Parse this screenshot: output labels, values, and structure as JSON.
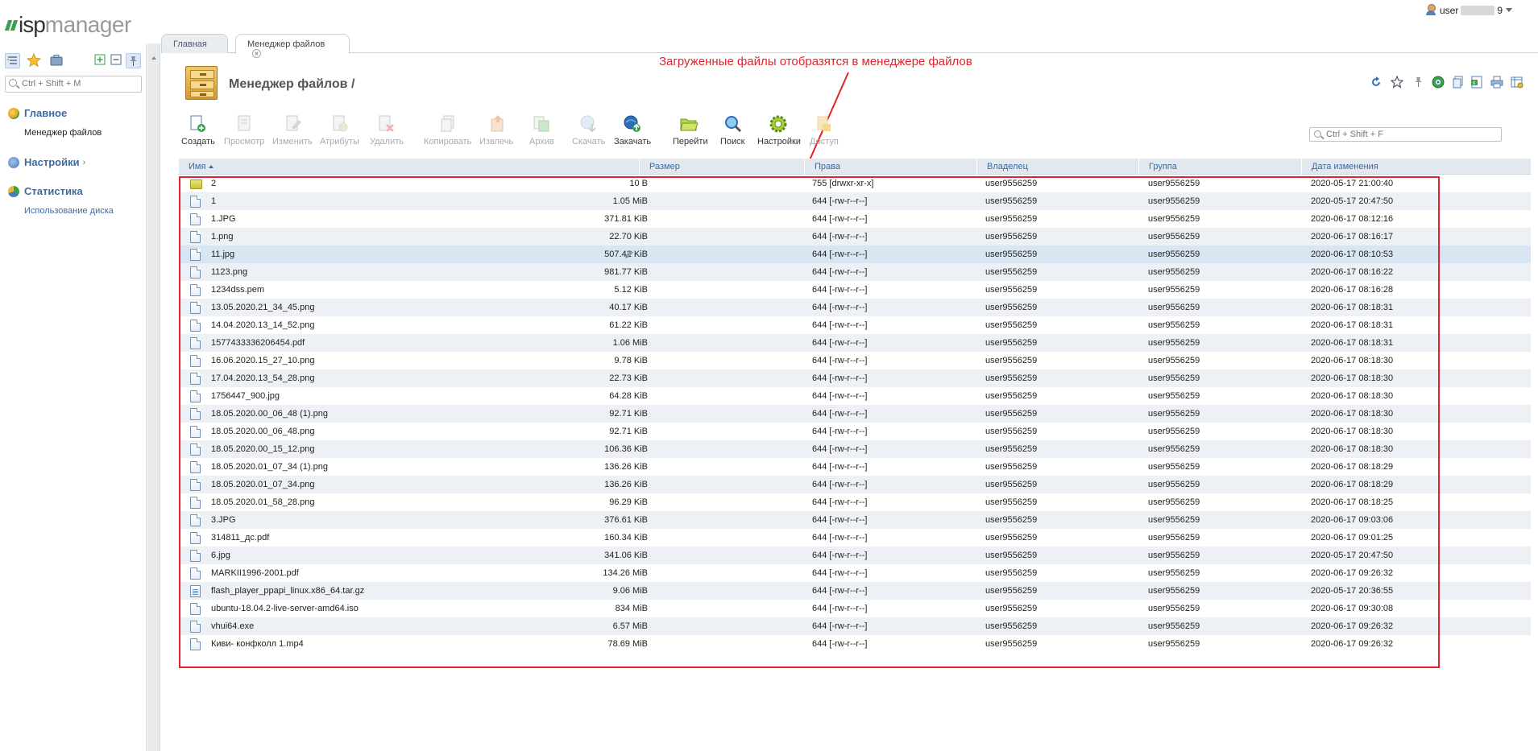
{
  "app": {
    "logo_isp": "isp",
    "logo_manager": "manager",
    "user_name": "user",
    "user_suffix": "9"
  },
  "sidebar": {
    "search_placeholder": "Ctrl + Shift + M",
    "sections": [
      {
        "label": "Главное",
        "items": [
          {
            "label": "Менеджер файлов"
          }
        ]
      },
      {
        "label": "Настройки",
        "chevron": "›"
      },
      {
        "label": "Статистика",
        "items": [
          {
            "label": "Использование диска"
          }
        ]
      }
    ]
  },
  "tabs": [
    {
      "label": "Главная",
      "active": false
    },
    {
      "label": "Менеджер файлов",
      "active": true
    }
  ],
  "page": {
    "title": "Менеджер файлов /"
  },
  "annotation": {
    "text": "Загруженные файлы отобразятся в менеджере файлов",
    "color": "#e3232b"
  },
  "toolbar": {
    "buttons": [
      {
        "label": "Создать",
        "icon": "file-plus-icon",
        "enabled": true
      },
      {
        "label": "Просмотр",
        "icon": "file-view-icon",
        "enabled": false
      },
      {
        "label": "Изменить",
        "icon": "file-edit-icon",
        "enabled": false
      },
      {
        "label": "Атрибуты",
        "icon": "attributes-gear-icon",
        "enabled": false
      },
      {
        "label": "Удалить",
        "icon": "delete-icon",
        "enabled": false
      },
      {
        "label": "Копировать",
        "icon": "copy-icon",
        "enabled": false
      },
      {
        "label": "Извлечь",
        "icon": "extract-icon",
        "enabled": false
      },
      {
        "label": "Архив",
        "icon": "archive-icon",
        "enabled": false
      },
      {
        "label": "Скачать",
        "icon": "download-icon",
        "enabled": false
      },
      {
        "label": "Закачать",
        "icon": "upload-icon",
        "enabled": true
      },
      {
        "label": "Перейти",
        "icon": "folder-open-icon",
        "enabled": true
      },
      {
        "label": "Поиск",
        "icon": "search-icon",
        "enabled": true
      },
      {
        "label": "Настройки",
        "icon": "settings-gear-icon",
        "enabled": true
      },
      {
        "label": "Доступ",
        "icon": "access-lock-icon",
        "enabled": false
      }
    ],
    "search_placeholder": "Ctrl + Shift + F"
  },
  "right_icons": [
    "refresh-icon",
    "favorite-star-icon",
    "pin-icon",
    "globe-icon",
    "copy-page-icon",
    "export-excel-icon",
    "print-icon",
    "columns-settings-icon"
  ],
  "table": {
    "columns": [
      "Имя",
      "Размер",
      "Права",
      "Владелец",
      "Группа",
      "Дата изменения"
    ],
    "rows": [
      {
        "name": "2",
        "type": "folder",
        "size": "10 B",
        "perm": "755 [drwxr-xr-x]",
        "owner": "user9556259",
        "group": "user9556259",
        "date": "2020-05-17 21:00:40"
      },
      {
        "name": "1",
        "type": "file",
        "size": "1.05 MiB",
        "perm": "644 [-rw-r--r--]",
        "owner": "user9556259",
        "group": "user9556259",
        "date": "2020-05-17 20:47:50"
      },
      {
        "name": "1.JPG",
        "type": "file",
        "size": "371.81 KiB",
        "perm": "644 [-rw-r--r--]",
        "owner": "user9556259",
        "group": "user9556259",
        "date": "2020-06-17 08:12:16"
      },
      {
        "name": "1.png",
        "type": "file",
        "size": "22.70 KiB",
        "perm": "644 [-rw-r--r--]",
        "owner": "user9556259",
        "group": "user9556259",
        "date": "2020-06-17 08:16:17"
      },
      {
        "name": "11.jpg",
        "type": "file",
        "size": "507.42 KiB",
        "perm": "644 [-rw-r--r--]",
        "owner": "user9556259",
        "group": "user9556259",
        "date": "2020-06-17 08:10:53",
        "selected": true
      },
      {
        "name": "1123.png",
        "type": "file",
        "size": "981.77 KiB",
        "perm": "644 [-rw-r--r--]",
        "owner": "user9556259",
        "group": "user9556259",
        "date": "2020-06-17 08:16:22"
      },
      {
        "name": "1234dss.pem",
        "type": "file",
        "size": "5.12 KiB",
        "perm": "644 [-rw-r--r--]",
        "owner": "user9556259",
        "group": "user9556259",
        "date": "2020-06-17 08:16:28"
      },
      {
        "name": "13.05.2020.21_34_45.png",
        "type": "file",
        "size": "40.17 KiB",
        "perm": "644 [-rw-r--r--]",
        "owner": "user9556259",
        "group": "user9556259",
        "date": "2020-06-17 08:18:31"
      },
      {
        "name": "14.04.2020.13_14_52.png",
        "type": "file",
        "size": "61.22 KiB",
        "perm": "644 [-rw-r--r--]",
        "owner": "user9556259",
        "group": "user9556259",
        "date": "2020-06-17 08:18:31"
      },
      {
        "name": "1577433336206454.pdf",
        "type": "file",
        "size": "1.06 MiB",
        "perm": "644 [-rw-r--r--]",
        "owner": "user9556259",
        "group": "user9556259",
        "date": "2020-06-17 08:18:31"
      },
      {
        "name": "16.06.2020.15_27_10.png",
        "type": "file",
        "size": "9.78 KiB",
        "perm": "644 [-rw-r--r--]",
        "owner": "user9556259",
        "group": "user9556259",
        "date": "2020-06-17 08:18:30"
      },
      {
        "name": "17.04.2020.13_54_28.png",
        "type": "file",
        "size": "22.73 KiB",
        "perm": "644 [-rw-r--r--]",
        "owner": "user9556259",
        "group": "user9556259",
        "date": "2020-06-17 08:18:30"
      },
      {
        "name": "1756447_900.jpg",
        "type": "file",
        "size": "64.28 KiB",
        "perm": "644 [-rw-r--r--]",
        "owner": "user9556259",
        "group": "user9556259",
        "date": "2020-06-17 08:18:30"
      },
      {
        "name": "18.05.2020.00_06_48 (1).png",
        "type": "file",
        "size": "92.71 KiB",
        "perm": "644 [-rw-r--r--]",
        "owner": "user9556259",
        "group": "user9556259",
        "date": "2020-06-17 08:18:30"
      },
      {
        "name": "18.05.2020.00_06_48.png",
        "type": "file",
        "size": "92.71 KiB",
        "perm": "644 [-rw-r--r--]",
        "owner": "user9556259",
        "group": "user9556259",
        "date": "2020-06-17 08:18:30"
      },
      {
        "name": "18.05.2020.00_15_12.png",
        "type": "file",
        "size": "106.36 KiB",
        "perm": "644 [-rw-r--r--]",
        "owner": "user9556259",
        "group": "user9556259",
        "date": "2020-06-17 08:18:30"
      },
      {
        "name": "18.05.2020.01_07_34 (1).png",
        "type": "file",
        "size": "136.26 KiB",
        "perm": "644 [-rw-r--r--]",
        "owner": "user9556259",
        "group": "user9556259",
        "date": "2020-06-17 08:18:29"
      },
      {
        "name": "18.05.2020.01_07_34.png",
        "type": "file",
        "size": "136.26 KiB",
        "perm": "644 [-rw-r--r--]",
        "owner": "user9556259",
        "group": "user9556259",
        "date": "2020-06-17 08:18:29"
      },
      {
        "name": "18.05.2020.01_58_28.png",
        "type": "file",
        "size": "96.29 KiB",
        "perm": "644 [-rw-r--r--]",
        "owner": "user9556259",
        "group": "user9556259",
        "date": "2020-06-17 08:18:25"
      },
      {
        "name": "3.JPG",
        "type": "file",
        "size": "376.61 KiB",
        "perm": "644 [-rw-r--r--]",
        "owner": "user9556259",
        "group": "user9556259",
        "date": "2020-06-17 09:03:06"
      },
      {
        "name": "314811_дс.pdf",
        "type": "file",
        "size": "160.34 KiB",
        "perm": "644 [-rw-r--r--]",
        "owner": "user9556259",
        "group": "user9556259",
        "date": "2020-06-17 09:01:25"
      },
      {
        "name": "6.jpg",
        "type": "file",
        "size": "341.06 KiB",
        "perm": "644 [-rw-r--r--]",
        "owner": "user9556259",
        "group": "user9556259",
        "date": "2020-05-17 20:47:50"
      },
      {
        "name": "MARKII1996-2001.pdf",
        "type": "file",
        "size": "134.26 MiB",
        "perm": "644 [-rw-r--r--]",
        "owner": "user9556259",
        "group": "user9556259",
        "date": "2020-06-17 09:26:32"
      },
      {
        "name": "flash_player_ppapi_linux.x86_64.tar.gz",
        "type": "archive",
        "size": "9.06 MiB",
        "perm": "644 [-rw-r--r--]",
        "owner": "user9556259",
        "group": "user9556259",
        "date": "2020-05-17 20:36:55"
      },
      {
        "name": "ubuntu-18.04.2-live-server-amd64.iso",
        "type": "file",
        "size": "834 MiB",
        "perm": "644 [-rw-r--r--]",
        "owner": "user9556259",
        "group": "user9556259",
        "date": "2020-06-17 09:30:08"
      },
      {
        "name": "vhui64.exe",
        "type": "file",
        "size": "6.57 MiB",
        "perm": "644 [-rw-r--r--]",
        "owner": "user9556259",
        "group": "user9556259",
        "date": "2020-06-17 09:26:32"
      },
      {
        "name": "Киви- конфколл 1.mp4",
        "type": "file",
        "size": "78.69 MiB",
        "perm": "644 [-rw-r--r--]",
        "owner": "user9556259",
        "group": "user9556259",
        "date": "2020-06-17 09:26:32"
      }
    ]
  },
  "colors": {
    "accent": "#3d6aa5",
    "annotation": "#e3232b",
    "row_alt": "#edf1f5",
    "row_selected": "#d8e6f3",
    "header_bg": "#e2e8ee"
  }
}
